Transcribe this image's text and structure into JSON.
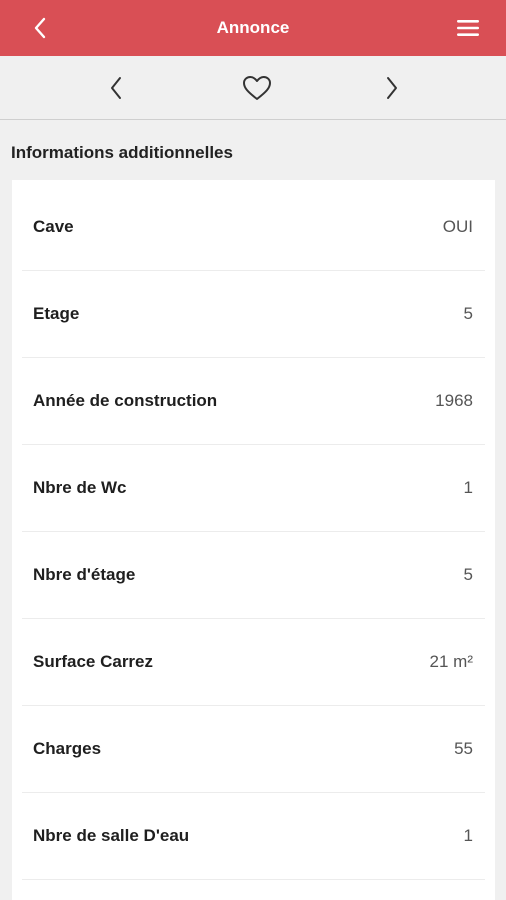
{
  "header": {
    "title": "Annonce",
    "back_icon": "chevron-left-icon",
    "menu_icon": "hamburger-menu-icon",
    "bg_color": "#d94f55"
  },
  "navigation": {
    "prev_icon": "chevron-left-icon",
    "favorite_icon": "heart-outline-icon",
    "next_icon": "chevron-right-icon"
  },
  "section": {
    "title": "Informations additionnelles"
  },
  "details": [
    {
      "label": "Cave",
      "value": "OUI"
    },
    {
      "label": "Etage",
      "value": "5"
    },
    {
      "label": "Année de construction",
      "value": "1968"
    },
    {
      "label": "Nbre de Wc",
      "value": "1"
    },
    {
      "label": "Nbre d'étage",
      "value": "5"
    },
    {
      "label": "Surface Carrez",
      "value": "21 m²"
    },
    {
      "label": "Charges",
      "value": "55"
    },
    {
      "label": "Nbre de salle D'eau",
      "value": "1"
    }
  ]
}
